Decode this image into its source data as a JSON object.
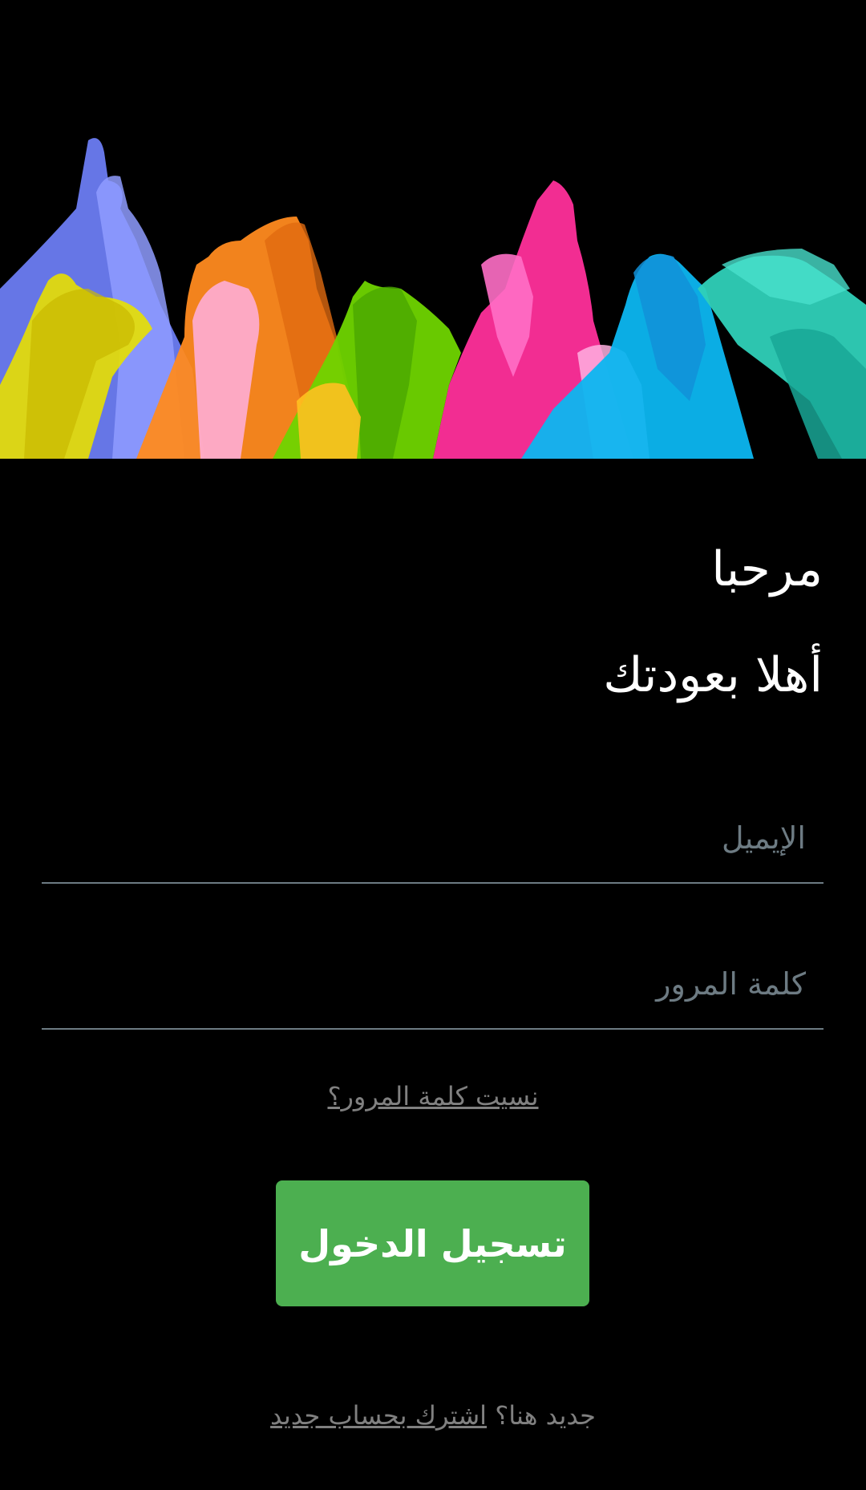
{
  "hero": {
    "image_name": "colorful-raised-hands-illustration",
    "colors": [
      "#6b7cf2",
      "#e8e000",
      "#ff8a1f",
      "#ffb0e0",
      "#6fd400",
      "#ff2f9a",
      "#0cb6f0",
      "#2fd0b8"
    ]
  },
  "greeting": {
    "line1": "مرحبا",
    "line2": "أهلا بعودتك"
  },
  "form": {
    "email_placeholder": "الإيميل",
    "email_value": "",
    "password_placeholder": "كلمة المرور",
    "password_value": ""
  },
  "forgot_password": "نسيت كلمة المرور؟",
  "login_button": "تسجيل الدخول",
  "signup": {
    "prompt": "جديد هنا؟",
    "link": "اشترك بحساب جديد"
  },
  "colors": {
    "background": "#000000",
    "accent": "#4caf50",
    "muted_text": "#808080",
    "field_line": "#6d7b83"
  }
}
